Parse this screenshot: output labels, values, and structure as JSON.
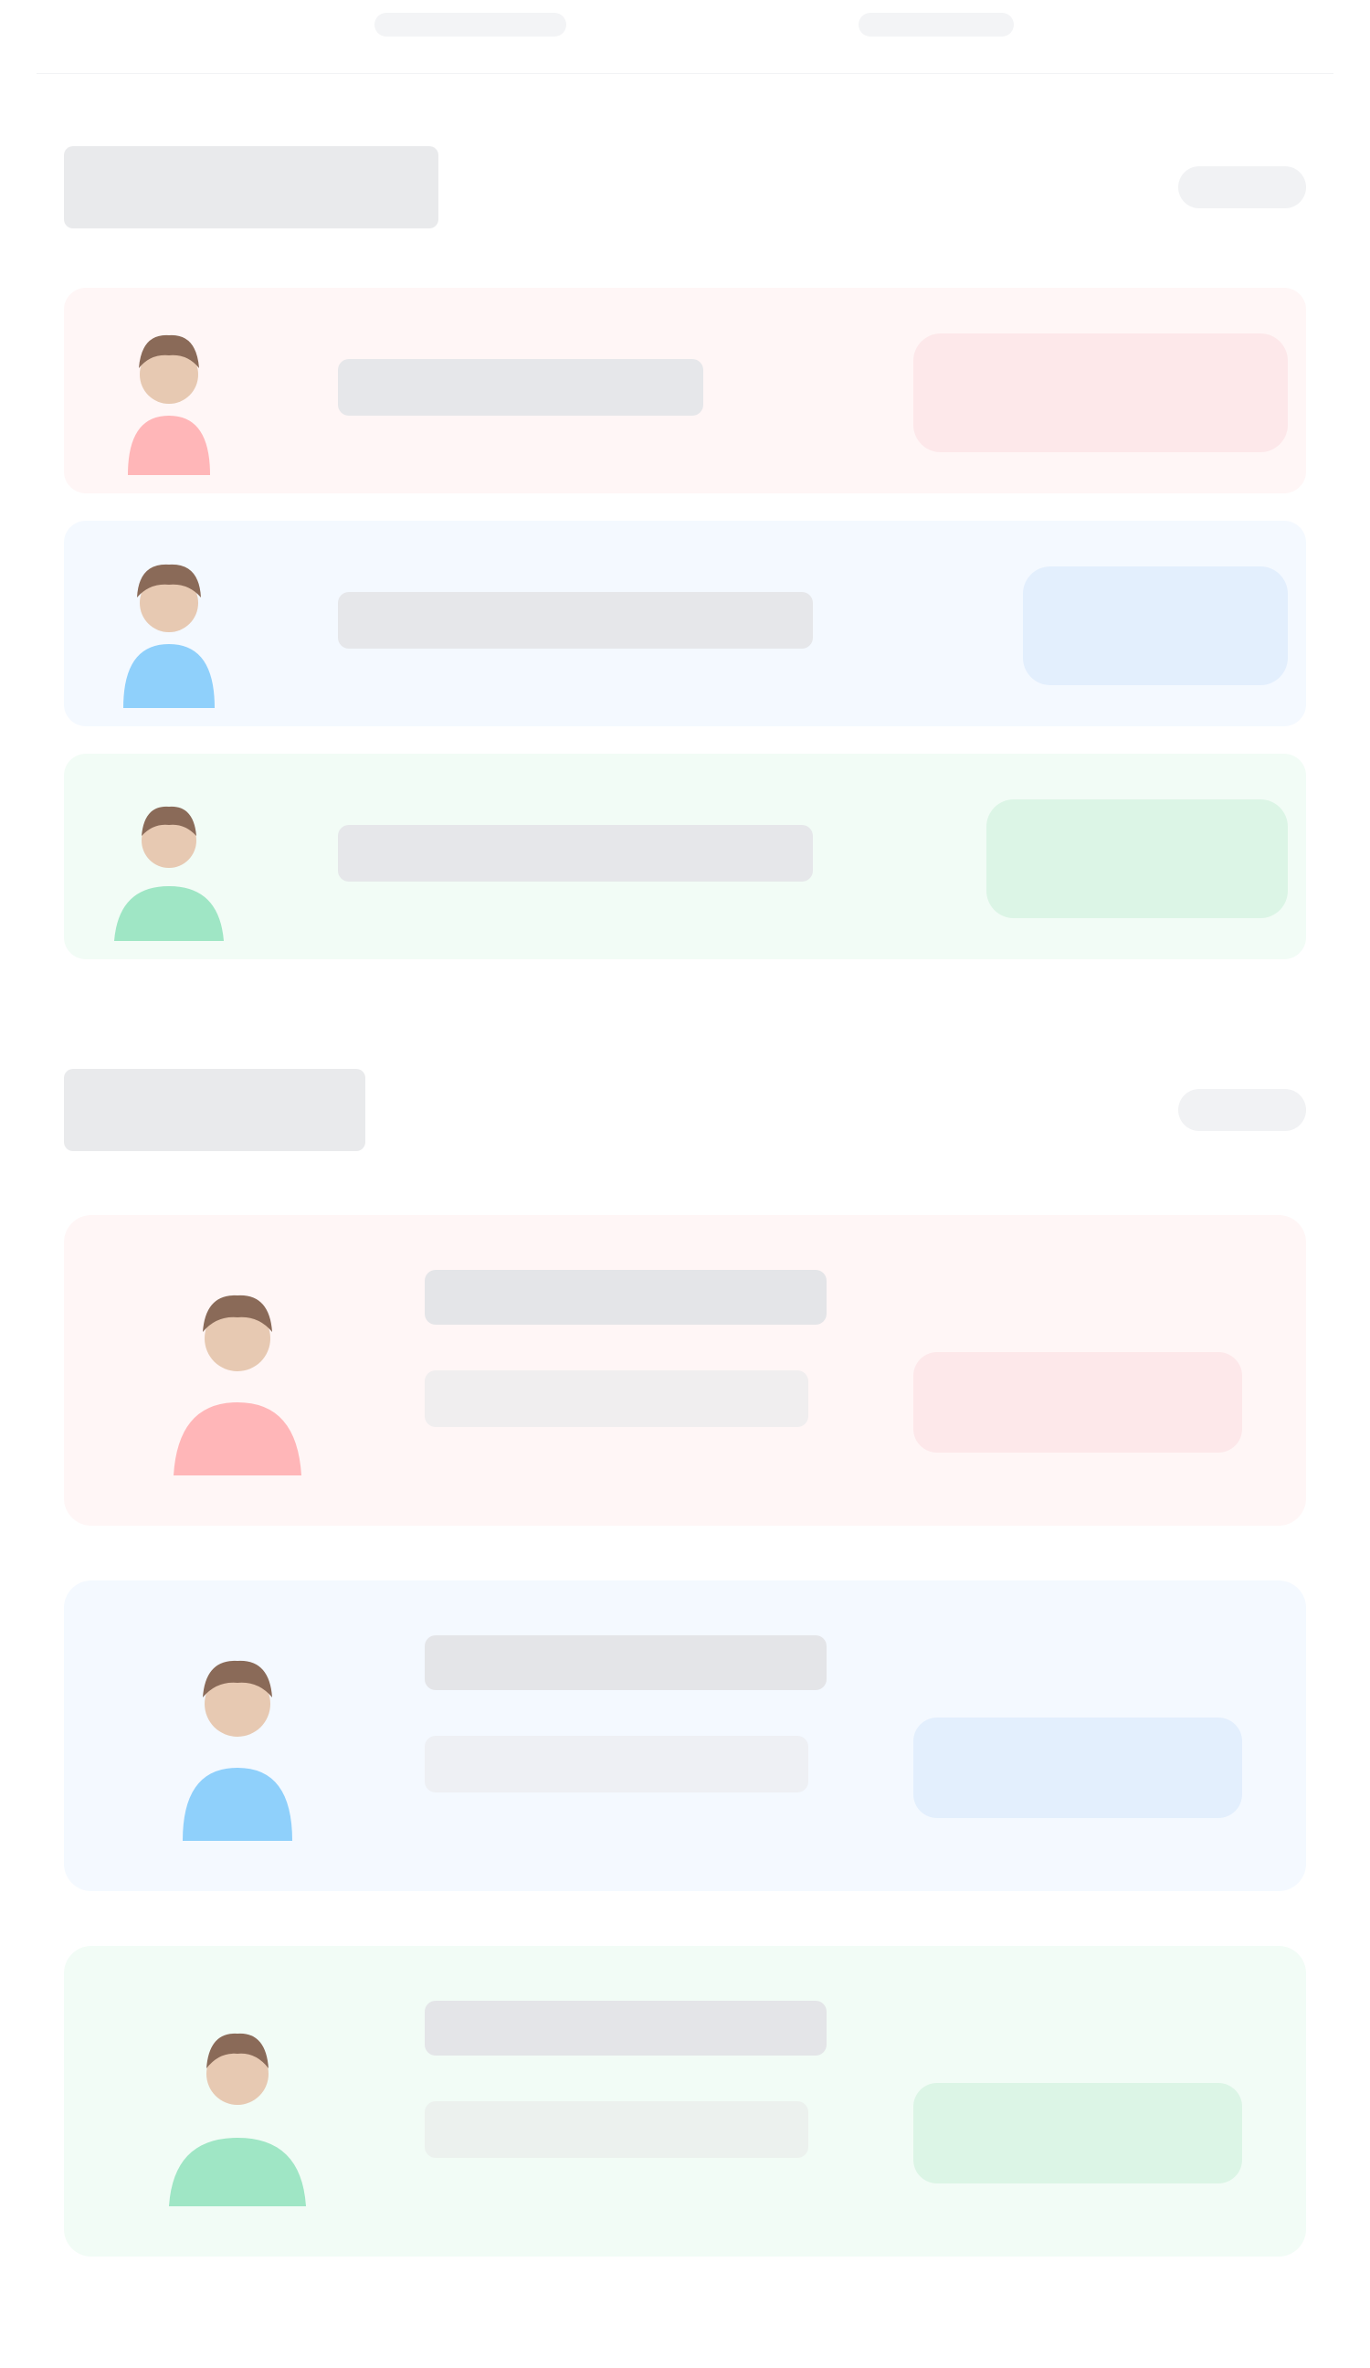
{
  "theme": {
    "red_bg": "#fff6f6",
    "red_accent": "#ffb6b8",
    "red_tag": "#fde8ea",
    "blue_bg": "#f4f9ff",
    "blue_accent": "#8fd0fb",
    "blue_tag": "#e3effd",
    "green_bg": "#f2fcf6",
    "green_accent": "#9fe6c5",
    "green_tag": "#dcf5e6",
    "skin": "#e7c9b2",
    "hair": "#8a6a58"
  },
  "section_ranking": {
    "title": "",
    "more": ""
  },
  "ranking": [
    {
      "name": "",
      "action": "",
      "color": "red"
    },
    {
      "name": "",
      "action": "",
      "color": "blue"
    },
    {
      "name": "",
      "action": "",
      "color": "green"
    }
  ],
  "section_messages": {
    "title": "",
    "more": ""
  },
  "messages": [
    {
      "title": "",
      "body": "",
      "tag": "",
      "color": "red"
    },
    {
      "title": "",
      "body": "",
      "tag": "",
      "color": "blue"
    },
    {
      "title": "",
      "body": "",
      "tag": "",
      "color": "green"
    }
  ]
}
